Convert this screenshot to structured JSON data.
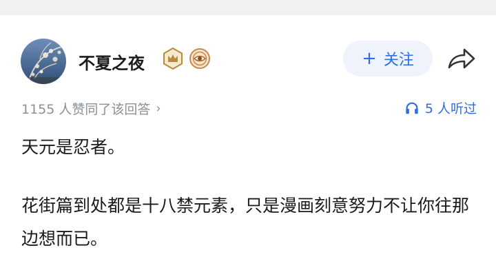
{
  "author": {
    "name": "不夏之夜",
    "badges": [
      "crown-badge-icon",
      "eye-badge-icon"
    ]
  },
  "actions": {
    "follow_label": "关注",
    "follow_icon": "plus-icon",
    "share_icon": "share-icon"
  },
  "stats": {
    "upvote_text": "1155 人赞同了该回答",
    "listeners_text": "5 人听过"
  },
  "content": {
    "paragraphs": [
      "天元是忍者。",
      "花街篇到处都是十八禁元素，只是漫画刻意努力不让你往那边想而已。"
    ]
  },
  "colors": {
    "accent": "#2f6de1",
    "muted": "#8a8f99",
    "follow_bg": "#eef3fc",
    "badge_gold": "#b88a3b"
  }
}
